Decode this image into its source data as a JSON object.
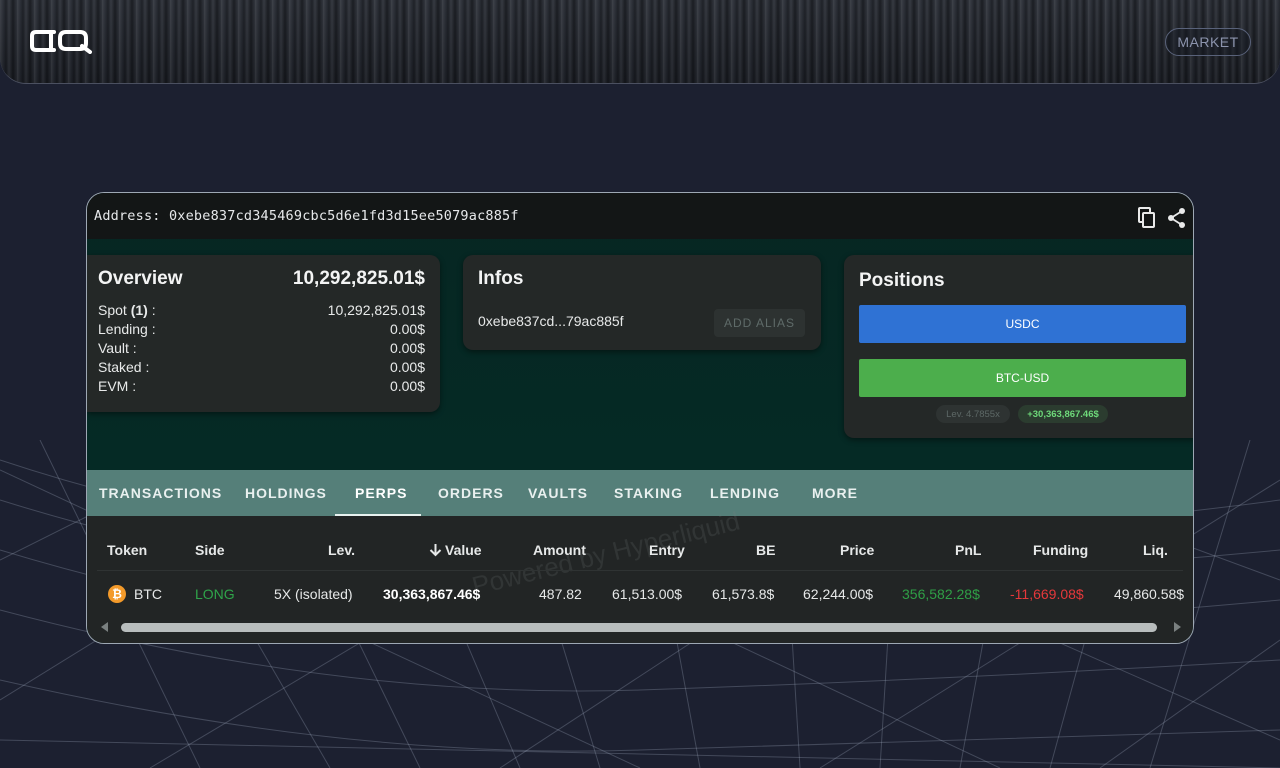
{
  "header": {
    "logo_text": "CIQ",
    "market_label": "MARKET"
  },
  "address_bar": {
    "label": "Address:",
    "address": "0xebe837cd345469cbc5d6e1fd3d15ee5079ac885f",
    "icons": [
      "copy-icon",
      "share-icon"
    ]
  },
  "overview": {
    "title": "Overview",
    "total": "10,292,825.01$",
    "rows": [
      {
        "key_prefix": "Spot ",
        "key_count": "(1)",
        "key_suffix": " :",
        "value": "10,292,825.01$"
      },
      {
        "key": "Lending :",
        "value": "0.00$"
      },
      {
        "key": "Vault :",
        "value": "0.00$"
      },
      {
        "key": "Staked :",
        "value": "0.00$"
      },
      {
        "key": "EVM :",
        "value": "0.00$"
      }
    ]
  },
  "infos": {
    "title": "Infos",
    "short_address": "0xebe837cd...79ac885f",
    "add_alias_label": "ADD ALIAS"
  },
  "positions": {
    "title": "Positions",
    "buttons": [
      "USDC",
      "BTC-USD"
    ],
    "leverage": "Lev. 4.7855x",
    "pnl": "+30,363,867.46$"
  },
  "tabs": {
    "items": [
      "TRANSACTIONS",
      "HOLDINGS",
      "PERPS",
      "ORDERS",
      "VAULTS",
      "STAKING",
      "LENDING",
      "MORE"
    ],
    "active": "PERPS"
  },
  "table": {
    "headers": [
      "Token",
      "Side",
      "Lev.",
      "Value",
      "Amount",
      "Entry",
      "BE",
      "Price",
      "PnL",
      "Funding",
      "Liq."
    ],
    "sort_icon": "arrow-down-icon",
    "rows": [
      {
        "token": "BTC",
        "side": "LONG",
        "lev": "5X (isolated)",
        "value": "30,363,867.46$",
        "amount": "487.82",
        "entry": "61,513.00$",
        "be": "61,573.8$",
        "price": "62,244.00$",
        "pnl": "356,582.28$",
        "funding": "-11,669.08$",
        "liq": "49,860.58$"
      }
    ]
  },
  "watermark": "Powered by Hyperliquid",
  "colors": {
    "usdc_button": "#2f72d4",
    "btc_button": "#4cae4c",
    "tabs_bg": "#557f79",
    "long": "#2fa44a",
    "negative": "#e5383b"
  }
}
